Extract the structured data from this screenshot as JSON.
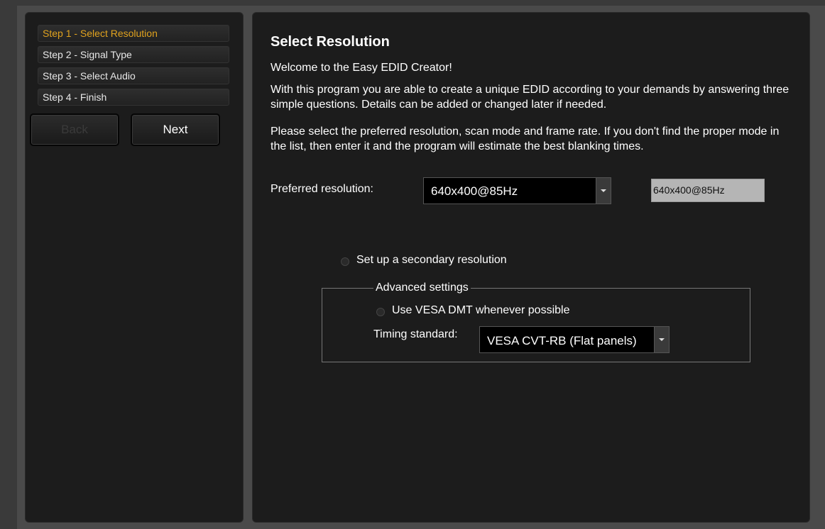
{
  "steps": [
    {
      "label": "Step 1 - Select Resolution",
      "active": true
    },
    {
      "label": "Step 2 - Signal Type",
      "active": false
    },
    {
      "label": "Step 3 - Select Audio",
      "active": false
    },
    {
      "label": "Step 4 - Finish",
      "active": false
    }
  ],
  "nav": {
    "back_label": "Back",
    "next_label": "Next"
  },
  "content": {
    "title": "Select Resolution",
    "welcome": "Welcome to the Easy EDID Creator!",
    "intro": "With this program you are able to create a unique EDID according to your demands by answering three simple questions. Details can be added or changed later if needed.",
    "instructions": "Please select the preferred resolution, scan mode and frame rate. If you don't find the proper mode in the list, then enter it and the program will estimate the best blanking times.",
    "preferred_label": "Preferred resolution:",
    "preferred_value": "640x400@85Hz",
    "preferred_entry": "640x400@85Hz",
    "secondary_label": "Set up a secondary resolution",
    "advanced_legend": "Advanced settings",
    "vesa_label": "Use VESA DMT whenever possible",
    "timing_label": "Timing standard:",
    "timing_value": "VESA CVT-RB (Flat panels)"
  },
  "colors": {
    "accent": "#e0a21e",
    "panel": "#1c1c1c",
    "background": "#3a3a3a"
  }
}
